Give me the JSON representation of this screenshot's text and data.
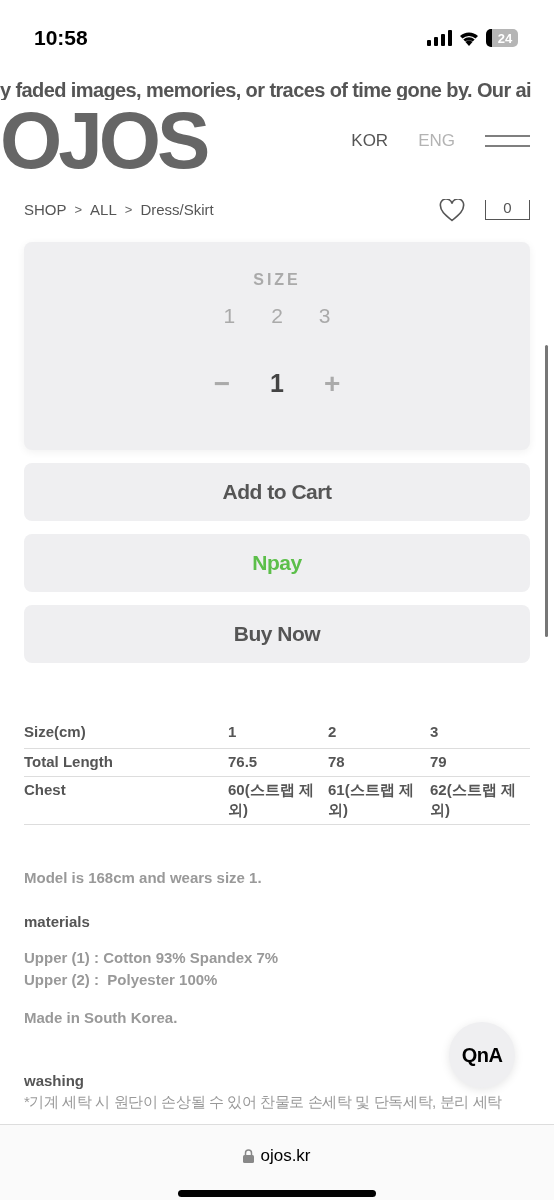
{
  "status_bar": {
    "time": "10:58",
    "battery": "24"
  },
  "marquee": "y faded images, memories, or traces of time gone by. Our ai",
  "header": {
    "logo": "OJOS",
    "languages": [
      {
        "label": "KOR",
        "selected": true
      },
      {
        "label": "ENG",
        "selected": false
      }
    ]
  },
  "breadcrumb": [
    "SHOP",
    "ALL",
    "Dress/Skirt"
  ],
  "breadcrumb_separator": ">",
  "cart_count": "0",
  "size_picker": {
    "title": "SIZE",
    "options": [
      {
        "label": "1",
        "selected": false
      },
      {
        "label": "2",
        "selected": false
      },
      {
        "label": "3",
        "selected": false
      }
    ],
    "minus": "−",
    "quantity": "1",
    "plus": "+"
  },
  "buttons": [
    {
      "label": "Add to Cart",
      "kind": "plain"
    },
    {
      "label": "Npay",
      "kind": "npay"
    },
    {
      "label": "Buy Now",
      "kind": "plain"
    }
  ],
  "size_table": {
    "columns": [
      "Size(cm)",
      "1",
      "2",
      "3"
    ],
    "rows": [
      [
        "Total Length",
        "76.5",
        "78",
        "79"
      ],
      [
        "Chest",
        "60(스트랩 제외)",
        "61(스트랩 제외)",
        "62(스트랩 제외)"
      ]
    ]
  },
  "model_note": "Model is 168cm and wears size 1.",
  "materials": {
    "title": "materials",
    "lines": [
      "Upper (1) : Cotton 93% Spandex 7%",
      "Upper (2) :  Polyester 100%"
    ]
  },
  "origin": "Made in South Korea.",
  "washing": {
    "title": "washing",
    "text": "*기계 세탁 시 원단이 손상될 수 있어 찬물로 손세탁 및 단독세탁, 분리 세탁"
  },
  "qna_button": "QnA",
  "address_bar": {
    "url": "ojos.kr"
  }
}
